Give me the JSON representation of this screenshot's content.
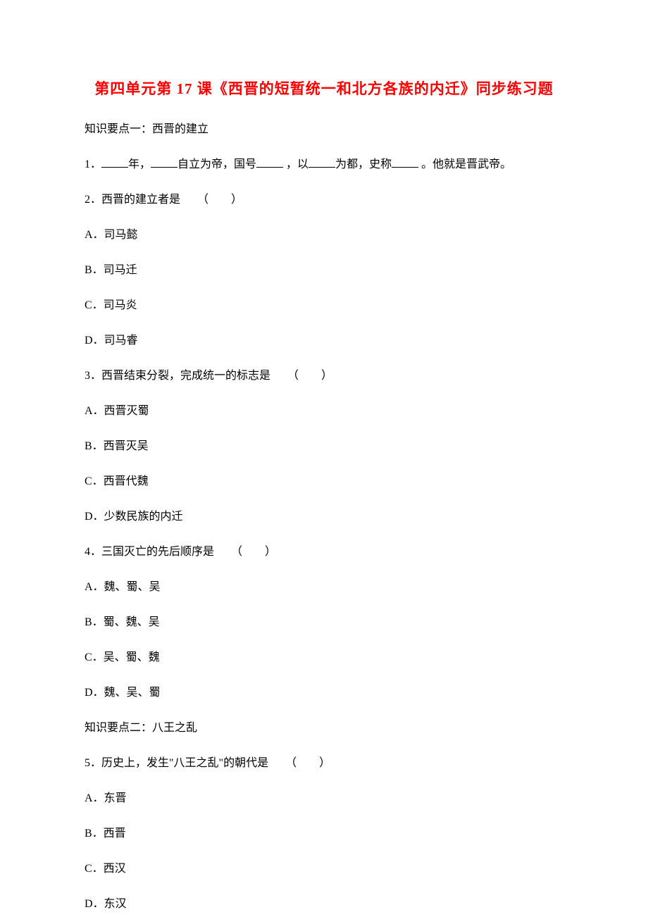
{
  "title": "第四单元第 17 课《西晋的短暂统一和北方各族的内迁》同步练习题",
  "section1": "知识要点一：西晋的建立",
  "q1_part1": "1．",
  "q1_part2": "年，",
  "q1_part3": "自立为帝，国号",
  "q1_part4": " ，以",
  "q1_part5": "为都，史称",
  "q1_part6": " 。他就是晋武帝。",
  "q2": "2．西晋的建立者是　　（　　）",
  "q2a": "A．司马懿",
  "q2b": "B．司马迁",
  "q2c": "C．司马炎",
  "q2d": "D．司马睿",
  "q3": "3．西晋结束分裂，完成统一的标志是　　（　　）",
  "q3a": "A．西晋灭蜀",
  "q3b": "B．西晋灭吴",
  "q3c": "C．西晋代魏",
  "q3d": "D．少数民族的内迁",
  "q4": "4．三国灭亡的先后顺序是　　（　　）",
  "q4a": "A．魏、蜀、吴",
  "q4b": "B．蜀、魏、吴",
  "q4c": "C．吴、蜀、魏",
  "q4d": "D．魏、吴、蜀",
  "section2": "知识要点二：八王之乱",
  "q5": "5．历史上，发生\"八王之乱\"的朝代是　　（　　）",
  "q5a": "A．东晋",
  "q5b": "B．西晋",
  "q5c": "C．西汉",
  "q5d": "D．东汉"
}
